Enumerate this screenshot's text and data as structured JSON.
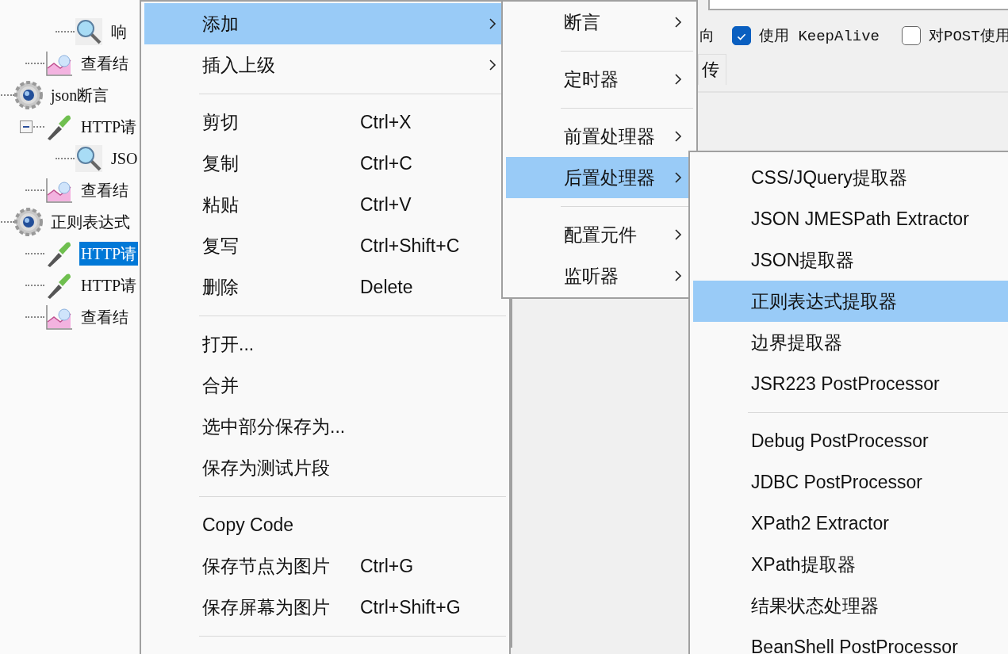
{
  "tree": {
    "items": [
      {
        "children": [
          {
            "children": [
              {
                "label": "响",
                "kind": "assertion",
                "selected": false
              }
            ]
          },
          {
            "label": "查看结",
            "kind": "listener",
            "selected": false
          }
        ]
      },
      {
        "label": "json断言",
        "kind": "group",
        "selected": false,
        "children": [
          {
            "label": "HTTP请",
            "kind": "sampler",
            "selected": false,
            "expanded": true,
            "children": [
              {
                "label": "JSO",
                "kind": "assertion",
                "selected": false
              }
            ]
          },
          {
            "label": "查看结",
            "kind": "listener",
            "selected": false
          }
        ]
      },
      {
        "label": "正则表达式",
        "kind": "group",
        "selected": false,
        "children": [
          {
            "label": "HTTP请",
            "kind": "sampler",
            "selected": true
          },
          {
            "label": "HTTP请",
            "kind": "sampler",
            "selected": false
          },
          {
            "label": "查看结",
            "kind": "listener",
            "selected": false
          }
        ]
      }
    ]
  },
  "options": [
    {
      "kind": "text",
      "label": "向"
    },
    {
      "kind": "checkbox",
      "label": "使用 KeepAlive",
      "checked": true
    },
    {
      "kind": "checkbox",
      "label": "对POST使用",
      "checked": false
    }
  ],
  "tabs": [
    {
      "label": "传"
    }
  ],
  "context_menu": {
    "items": [
      {
        "kind": "item",
        "label": "添加",
        "submenu": true,
        "selected": true
      },
      {
        "kind": "item",
        "label": "插入上级",
        "submenu": true,
        "selected": false
      },
      {
        "kind": "separator"
      },
      {
        "kind": "item",
        "label": "剪切",
        "shortcut": "Ctrl+X",
        "selected": false
      },
      {
        "kind": "item",
        "label": "复制",
        "shortcut": "Ctrl+C",
        "selected": false
      },
      {
        "kind": "item",
        "label": "粘贴",
        "shortcut": "Ctrl+V",
        "selected": false
      },
      {
        "kind": "item",
        "label": "复写",
        "shortcut": "Ctrl+Shift+C",
        "selected": false
      },
      {
        "kind": "item",
        "label": "删除",
        "shortcut": "Delete",
        "selected": false
      },
      {
        "kind": "separator"
      },
      {
        "kind": "item",
        "label": "打开...",
        "selected": false
      },
      {
        "kind": "item",
        "label": "合并",
        "selected": false
      },
      {
        "kind": "item",
        "label": "选中部分保存为...",
        "selected": false
      },
      {
        "kind": "item",
        "label": "保存为测试片段",
        "selected": false
      },
      {
        "kind": "separator"
      },
      {
        "kind": "item",
        "label": "Copy Code",
        "selected": false
      },
      {
        "kind": "item",
        "label": "保存节点为图片",
        "shortcut": "Ctrl+G",
        "selected": false
      },
      {
        "kind": "item",
        "label": "保存屏幕为图片",
        "shortcut": "Ctrl+Shift+G",
        "selected": false
      },
      {
        "kind": "separator"
      }
    ]
  },
  "add_submenu": {
    "items": [
      {
        "kind": "item",
        "label": "断言",
        "submenu": true,
        "selected": false
      },
      {
        "kind": "separator"
      },
      {
        "kind": "item",
        "label": "定时器",
        "submenu": true,
        "selected": false
      },
      {
        "kind": "separator"
      },
      {
        "kind": "item",
        "label": "前置处理器",
        "submenu": true,
        "selected": false
      },
      {
        "kind": "item",
        "label": "后置处理器",
        "submenu": true,
        "selected": true
      },
      {
        "kind": "separator"
      },
      {
        "kind": "item",
        "label": "配置元件",
        "submenu": true,
        "selected": false
      },
      {
        "kind": "item",
        "label": "监听器",
        "submenu": true,
        "selected": false
      }
    ]
  },
  "post_processor_submenu": {
    "items": [
      {
        "kind": "item",
        "label": "CSS/JQuery提取器",
        "selected": false
      },
      {
        "kind": "item",
        "label": "JSON JMESPath Extractor",
        "selected": false
      },
      {
        "kind": "item",
        "label": "JSON提取器",
        "selected": false
      },
      {
        "kind": "item",
        "label": "正则表达式提取器",
        "selected": true
      },
      {
        "kind": "item",
        "label": "边界提取器",
        "selected": false
      },
      {
        "kind": "item",
        "label": "JSR223 PostProcessor",
        "selected": false
      },
      {
        "kind": "separator"
      },
      {
        "kind": "item",
        "label": "Debug PostProcessor",
        "selected": false
      },
      {
        "kind": "item",
        "label": "JDBC PostProcessor",
        "selected": false
      },
      {
        "kind": "item",
        "label": "XPath2 Extractor",
        "selected": false
      },
      {
        "kind": "item",
        "label": "XPath提取器",
        "selected": false
      },
      {
        "kind": "item",
        "label": "结果状态处理器",
        "selected": false
      },
      {
        "kind": "item",
        "label": "BeanShell PostProcessor",
        "selected": false
      }
    ]
  }
}
